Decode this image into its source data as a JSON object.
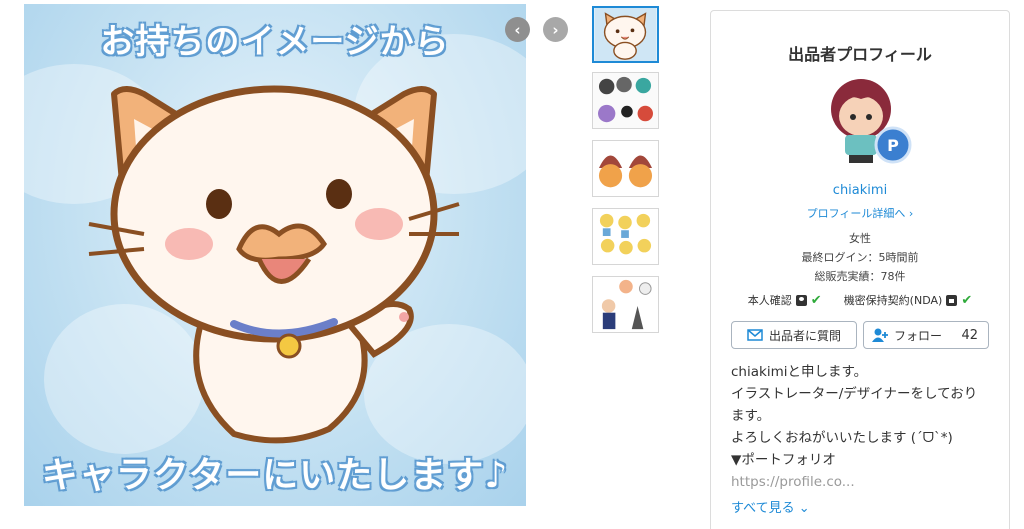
{
  "main_image": {
    "banner_top": "お持ちのイメージから",
    "banner_bottom": "キャラクターにいたします♪"
  },
  "gallery": {
    "prev_label": "‹",
    "next_label": "›",
    "thumbnails": [
      "thumb-1",
      "thumb-2",
      "thumb-3",
      "thumb-4",
      "thumb-5"
    ]
  },
  "profile": {
    "card_title": "出品者プロフィール",
    "username": "chiakimi",
    "detail_link": "プロフィール詳細へ ›",
    "gender": "女性",
    "last_login": "最終ログイン：5時間前",
    "total_sales": "総販売実績：78件",
    "identity_verified": "本人確認",
    "nda": "機密保持契約(NDA)",
    "check": "✔",
    "question_button": "出品者に質問",
    "follow_button": "フォロー",
    "follow_count": "42",
    "intro_lines": [
      "chiakimiと申します。",
      "イラストレーター/デザイナーをしており",
      "ます。",
      "よろしくおねがいいたします (´ᗜ`*)",
      "▼ポートフォリオ",
      "https://profile.co..."
    ],
    "see_all": "すべて見る ⌄"
  },
  "colors": {
    "accent": "#1e8ad6",
    "check": "#2eaa3a",
    "banner_outline": "#5e9bd0"
  }
}
